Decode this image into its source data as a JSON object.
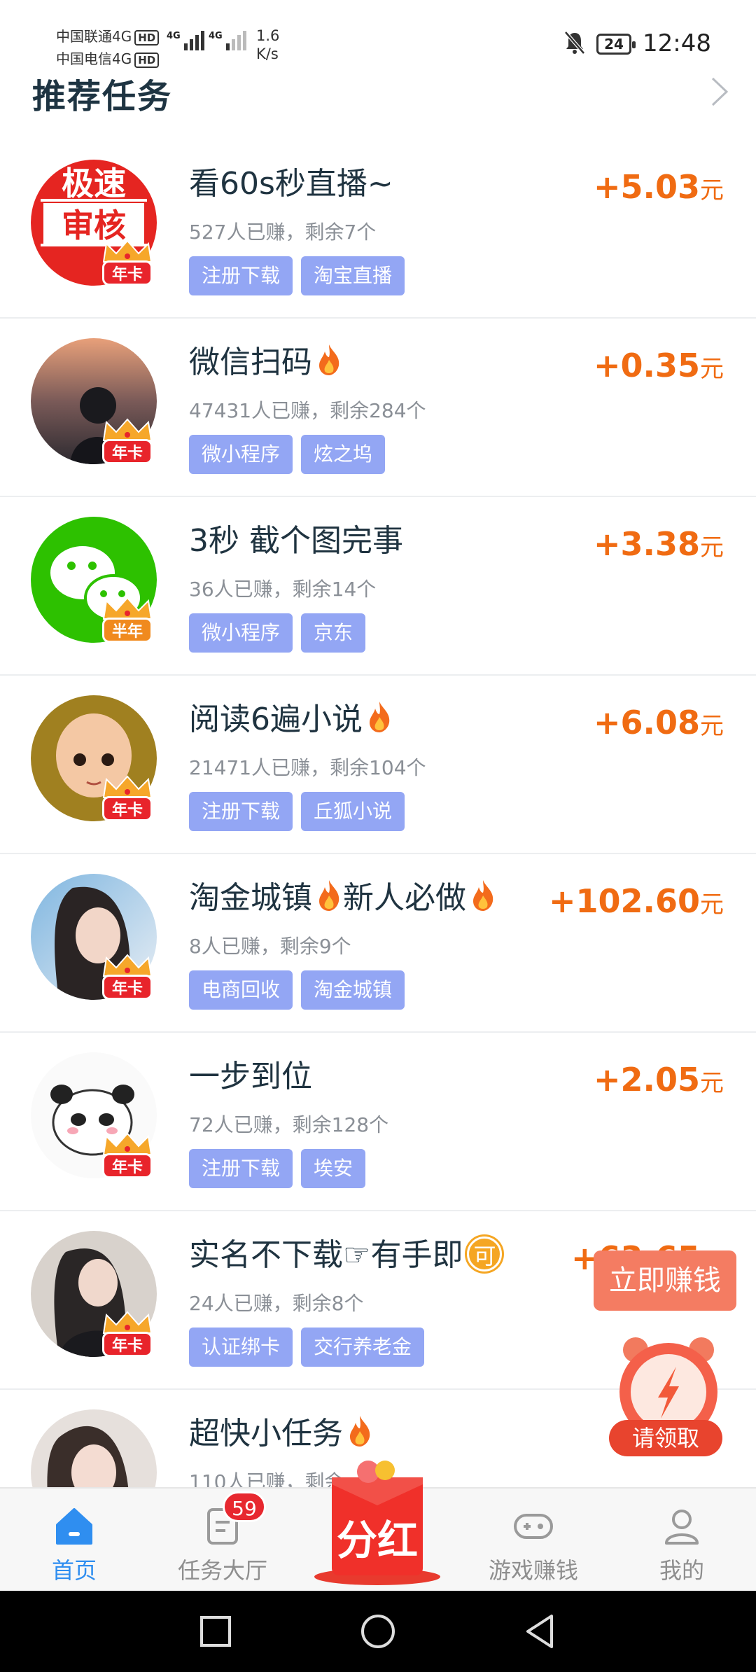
{
  "status_bar": {
    "carrier1": "中国联通4G",
    "carrier2": "中国电信4G",
    "hd": "HD",
    "net_type": "4G",
    "net_speed": "1.6",
    "net_speed_unit": "K/s",
    "battery": "24",
    "time": "12:48"
  },
  "header": {
    "title": "推荐任务"
  },
  "tasks": [
    {
      "title": "看60s秒直播~",
      "stats": "527人已赚，剩余7个",
      "tags": [
        "注册下载",
        "淘宝直播"
      ],
      "reward": "+5.03",
      "unit": "元",
      "badge": "年卡"
    },
    {
      "title": "微信扫码",
      "stats": "47431人已赚，剩余284个",
      "tags": [
        "微小程序",
        "炫之坞"
      ],
      "reward": "+0.35",
      "unit": "元",
      "badge": "年卡"
    },
    {
      "title": "3秒 截个图完事",
      "stats": "36人已赚，剩余14个",
      "tags": [
        "微小程序",
        "京东"
      ],
      "reward": "+3.38",
      "unit": "元",
      "badge": "半年"
    },
    {
      "title": "阅读6遍小说",
      "stats": "21471人已赚，剩余104个",
      "tags": [
        "注册下载",
        "丘狐小说"
      ],
      "reward": "+6.08",
      "unit": "元",
      "badge": "年卡"
    },
    {
      "title": "淘金城镇",
      "title2": "新人必做",
      "stats": "8人已赚，剩余9个",
      "tags": [
        "电商回收",
        "淘金城镇"
      ],
      "reward": "+102.60",
      "unit": "元",
      "badge": "年卡"
    },
    {
      "title": "一步到位",
      "stats": "72人已赚，剩余128个",
      "tags": [
        "注册下载",
        "埃安"
      ],
      "reward": "+2.05",
      "unit": "元",
      "badge": "年卡"
    },
    {
      "title": "实名不下载☞有手即",
      "ke": "可",
      "stats": "24人已赚，剩余8个",
      "tags": [
        "认证绑卡",
        "交行养老金"
      ],
      "reward": "+63.65",
      "unit": "元",
      "badge": "年卡"
    },
    {
      "title": "超快小任务",
      "stats": "110人已赚，剩余",
      "tags": [],
      "reward": "",
      "unit": "",
      "badge": ""
    }
  ],
  "avatar_1": {
    "line1": "极速",
    "line2": "审核"
  },
  "floating": {
    "earn_now": "立即赚钱",
    "claim": "请领取"
  },
  "bottom_nav": {
    "home": "首页",
    "tasks": "任务大厅",
    "tasks_badge": "59",
    "bonus": "分红",
    "games": "游戏赚钱",
    "mine": "我的"
  },
  "colors": {
    "accent": "#2f8ef0",
    "reward": "#f06b12",
    "tag": "#93a6f4",
    "title": "#1f3340"
  }
}
